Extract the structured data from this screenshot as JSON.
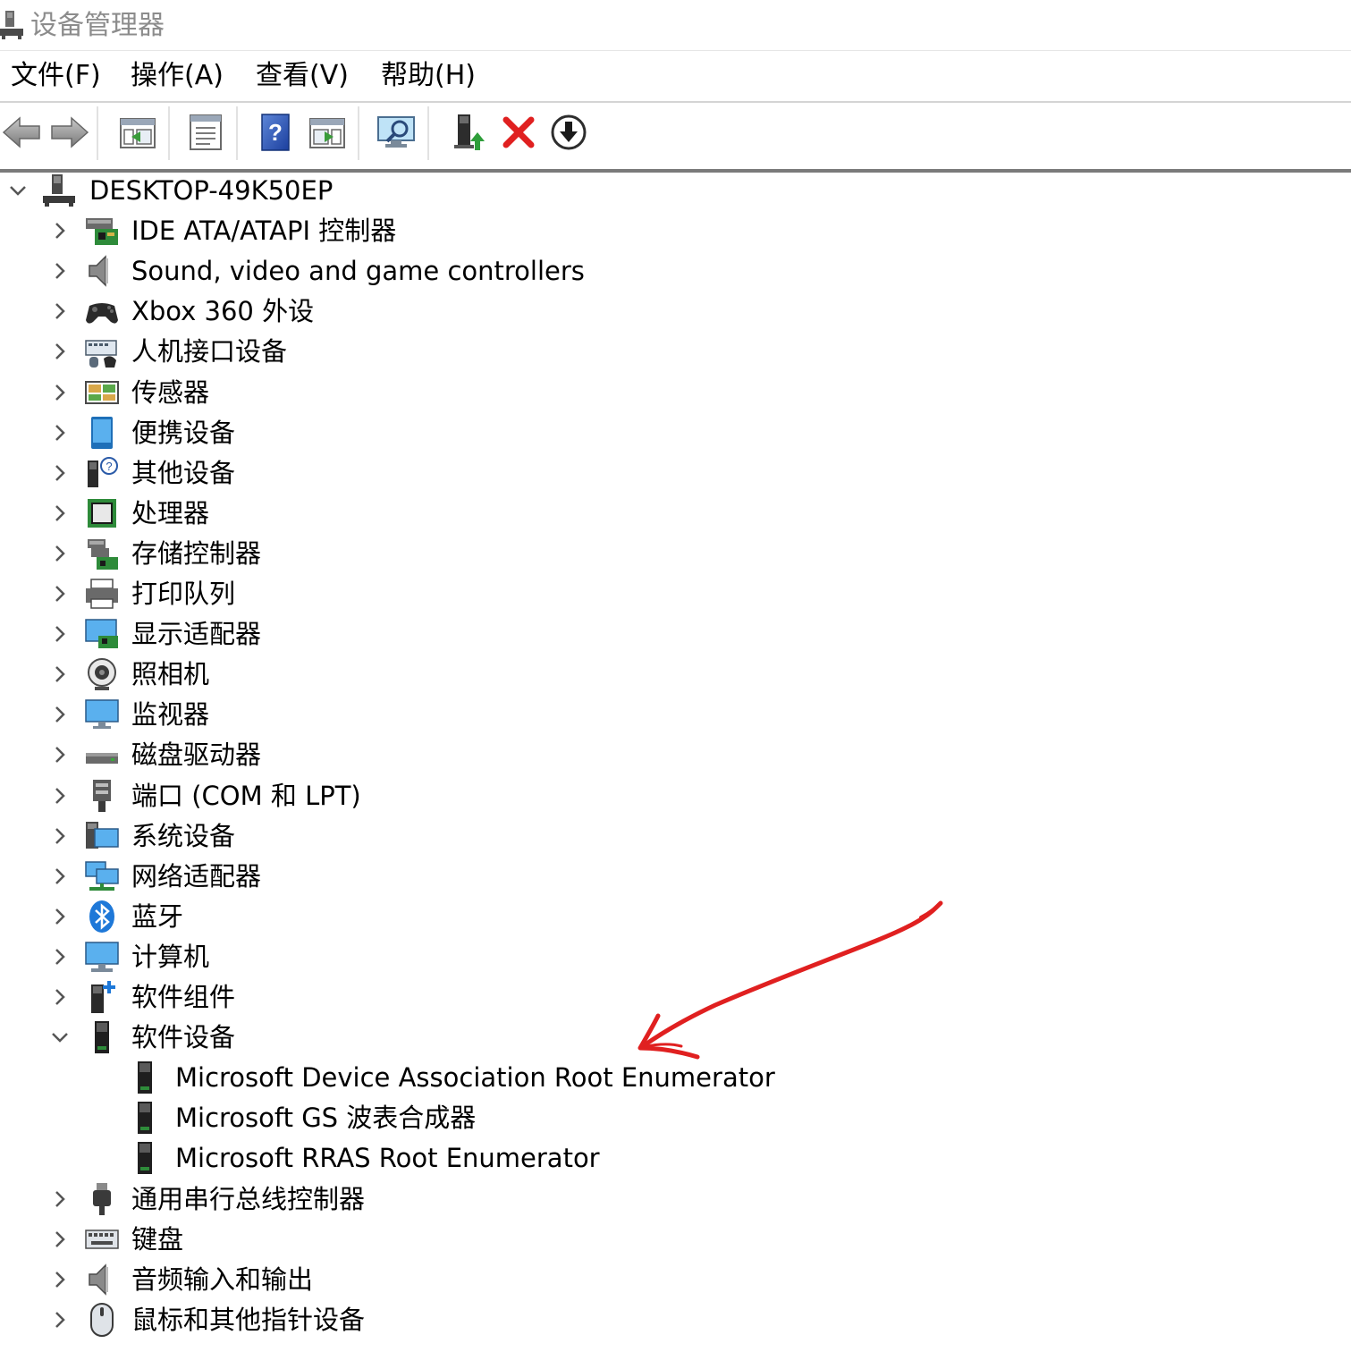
{
  "window": {
    "title": "设备管理器",
    "icon": "device-manager-icon"
  },
  "menu": [
    {
      "label": "文件(F)"
    },
    {
      "label": "操作(A)"
    },
    {
      "label": "查看(V)"
    },
    {
      "label": "帮助(H)"
    }
  ],
  "toolbar": {
    "buttons": [
      {
        "name": "back",
        "icon": "arrow-left-icon"
      },
      {
        "name": "forward",
        "icon": "arrow-right-icon"
      },
      {
        "name": "show-hide-console-tree",
        "icon": "console-tree-icon"
      },
      {
        "name": "properties",
        "icon": "properties-sheet-icon"
      },
      {
        "name": "help",
        "icon": "help-icon"
      },
      {
        "name": "action-pane",
        "icon": "action-pane-icon"
      },
      {
        "name": "scan-hardware-changes",
        "icon": "scan-monitor-icon"
      },
      {
        "name": "update-driver",
        "icon": "update-driver-icon"
      },
      {
        "name": "uninstall-device",
        "icon": "uninstall-x-icon"
      },
      {
        "name": "disable-device",
        "icon": "disable-down-arrow-icon"
      }
    ]
  },
  "tree": {
    "root": {
      "label": "DESKTOP-49K50EP",
      "icon": "computer-root-icon",
      "expanded": true
    },
    "categories": [
      {
        "label": "IDE ATA/ATAPI 控制器",
        "icon": "ide-controller-icon",
        "expanded": false
      },
      {
        "label": "Sound, video and game controllers",
        "icon": "speaker-icon",
        "expanded": false
      },
      {
        "label": "Xbox 360 外设",
        "icon": "gamepad-icon",
        "expanded": false
      },
      {
        "label": "人机接口设备",
        "icon": "hid-icon",
        "expanded": false
      },
      {
        "label": "传感器",
        "icon": "sensor-icon",
        "expanded": false
      },
      {
        "label": "便携设备",
        "icon": "portable-device-icon",
        "expanded": false
      },
      {
        "label": "其他设备",
        "icon": "other-device-icon",
        "expanded": false
      },
      {
        "label": "处理器",
        "icon": "processor-icon",
        "expanded": false
      },
      {
        "label": "存储控制器",
        "icon": "storage-controller-icon",
        "expanded": false
      },
      {
        "label": "打印队列",
        "icon": "printer-icon",
        "expanded": false
      },
      {
        "label": "显示适配器",
        "icon": "display-adapter-icon",
        "expanded": false
      },
      {
        "label": "照相机",
        "icon": "camera-icon",
        "expanded": false
      },
      {
        "label": "监视器",
        "icon": "monitor-icon",
        "expanded": false
      },
      {
        "label": "磁盘驱动器",
        "icon": "disk-drive-icon",
        "expanded": false
      },
      {
        "label": "端口 (COM 和 LPT)",
        "icon": "port-icon",
        "expanded": false
      },
      {
        "label": "系统设备",
        "icon": "system-device-icon",
        "expanded": false
      },
      {
        "label": "网络适配器",
        "icon": "network-adapter-icon",
        "expanded": false
      },
      {
        "label": "蓝牙",
        "icon": "bluetooth-icon",
        "expanded": false
      },
      {
        "label": "计算机",
        "icon": "computer-icon",
        "expanded": false
      },
      {
        "label": "软件组件",
        "icon": "software-component-icon",
        "expanded": false
      },
      {
        "label": "软件设备",
        "icon": "software-device-icon",
        "expanded": true,
        "children": [
          {
            "label": "Microsoft Device Association Root Enumerator",
            "icon": "software-device-icon"
          },
          {
            "label": "Microsoft GS 波表合成器",
            "icon": "software-device-icon"
          },
          {
            "label": "Microsoft RRAS Root Enumerator",
            "icon": "software-device-icon"
          }
        ]
      },
      {
        "label": "通用串行总线控制器",
        "icon": "usb-icon",
        "expanded": false
      },
      {
        "label": "键盘",
        "icon": "keyboard-icon",
        "expanded": false
      },
      {
        "label": "音频输入和输出",
        "icon": "speaker-icon",
        "expanded": false
      },
      {
        "label": "鼠标和其他指针设备",
        "icon": "mouse-icon",
        "expanded": false
      }
    ]
  },
  "colors": {
    "annotation_arrow": "#e02020",
    "title_text": "#8c8c8c",
    "toolbar_border": "#7a7a7a",
    "chevron": "#555555"
  }
}
